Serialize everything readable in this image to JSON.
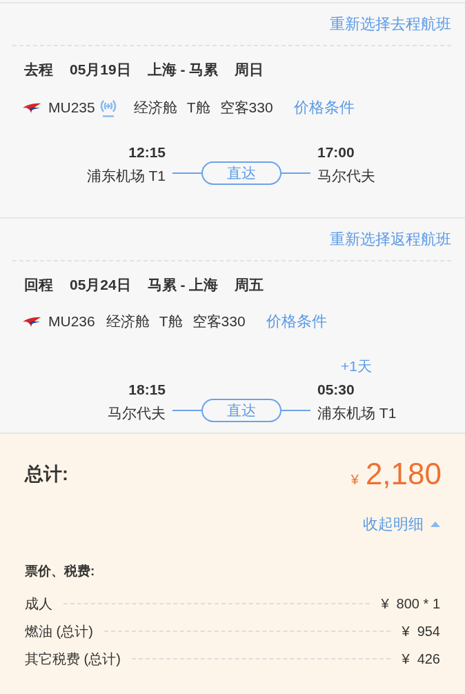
{
  "segments": [
    {
      "change_link": "重新选择去程航班",
      "direction": "去程",
      "date": "05月19日",
      "route": "上海 - 马累",
      "weekday": "周日",
      "flight_no": "MU235",
      "wifi": true,
      "cabin": "经济舱",
      "class": "T舱",
      "aircraft": "空客330",
      "price_rules": "价格条件",
      "dep_time": "12:15",
      "dep_airport": "浦东机场 T1",
      "stop_badge": "直达",
      "arr_time": "17:00",
      "arr_airport": "马尔代夫"
    },
    {
      "change_link": "重新选择返程航班",
      "direction": "回程",
      "date": "05月24日",
      "route": "马累 - 上海",
      "weekday": "周五",
      "flight_no": "MU236",
      "wifi": false,
      "cabin": "经济舱",
      "class": "T舱",
      "aircraft": "空客330",
      "price_rules": "价格条件",
      "dep_time": "18:15",
      "dep_airport": "马尔代夫",
      "stop_badge": "直达",
      "arr_time": "05:30",
      "arr_day_offset": "+1天",
      "arr_airport": "浦东机场 T1"
    }
  ],
  "total": {
    "label": "总计:",
    "currency": "¥",
    "amount": "2,180"
  },
  "details_toggle": {
    "label": "收起明细",
    "expanded": true
  },
  "fees": {
    "title": "票价、税费:",
    "rows": [
      {
        "label": "成人",
        "value": "¥  800 * 1"
      },
      {
        "label": "燃油 (总计)",
        "value": "¥  954"
      },
      {
        "label": "其它税费 (总计)",
        "value": "¥  426"
      }
    ]
  }
}
